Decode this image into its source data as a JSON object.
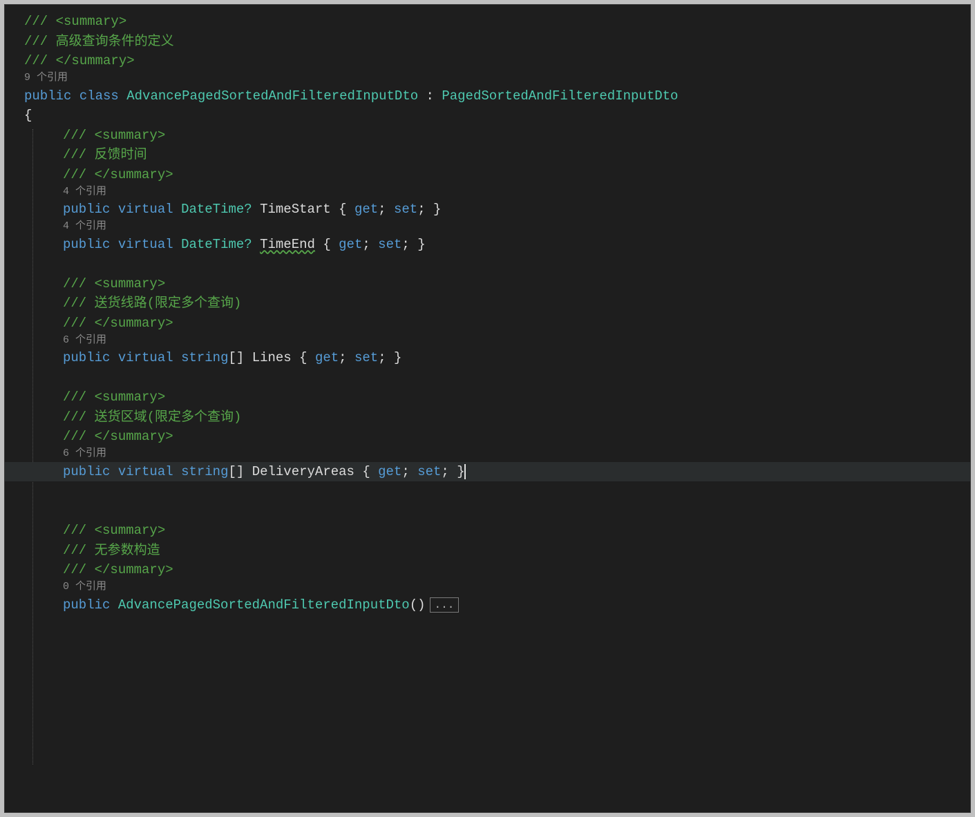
{
  "doc_summary": {
    "open": "/// <summary>",
    "text": "/// 高级查询条件的定义",
    "close": "/// </summary>"
  },
  "codelens": {
    "class_refs": "9 个引用",
    "timestart_refs": "4 个引用",
    "timeend_refs": "4 个引用",
    "lines_refs": "6 个引用",
    "deliveryareas_refs": "6 个引用",
    "ctor_refs": "0 个引用"
  },
  "tokens": {
    "public": "public",
    "class": "class",
    "virtual": "virtual",
    "get": "get",
    "set": "set",
    "string": "string",
    "datetime_nullable": "DateTime?",
    "class_name": "AdvancePagedSortedAndFilteredInputDto",
    "base_name": "PagedSortedAndFilteredInputDto",
    "colon": " : ",
    "open_brace": "{",
    "close_brace": "}",
    "array_brackets": "[]",
    "semi": ";",
    "paren_open": "(",
    "paren_close": ")",
    "sp": " "
  },
  "members": {
    "timestart": {
      "summary_open": "/// <summary>",
      "summary_text": "/// 反馈时间",
      "summary_close": "/// </summary>",
      "name": "TimeStart"
    },
    "timeend": {
      "name": "TimeEnd"
    },
    "lines": {
      "summary_open": "/// <summary>",
      "summary_text": "/// 送货线路(限定多个查询)",
      "summary_close": "/// </summary>",
      "name": "Lines"
    },
    "deliveryareas": {
      "summary_open": "/// <summary>",
      "summary_text": "/// 送货区域(限定多个查询)",
      "summary_close": "/// </summary>",
      "name": "DeliveryAreas"
    },
    "ctor": {
      "summary_open": "/// <summary>",
      "summary_text": "/// 无参数构造",
      "summary_close": "/// </summary>"
    }
  },
  "collapsed_label": "..."
}
